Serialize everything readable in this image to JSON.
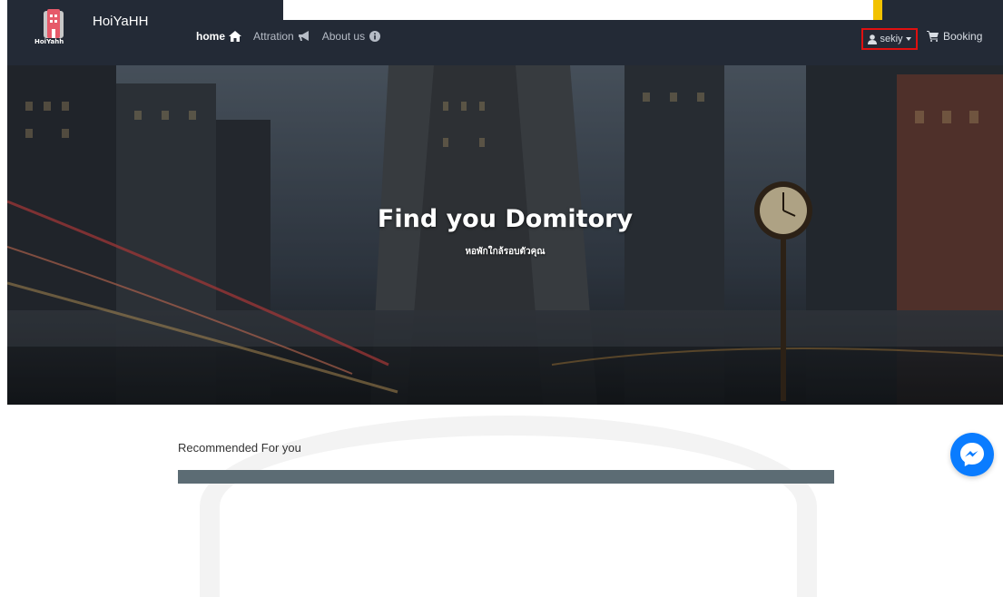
{
  "brand": {
    "name": "HoiYaHH",
    "logo_caption": "HoiYahh"
  },
  "nav": {
    "items": [
      {
        "label": "home",
        "icon": "home-icon",
        "active": true
      },
      {
        "label": "Attration",
        "icon": "bullhorn-icon",
        "active": false
      },
      {
        "label": "About us",
        "icon": "info-icon",
        "active": false
      }
    ]
  },
  "user_menu": {
    "label": "sekiy",
    "icon": "user-icon"
  },
  "booking": {
    "label": "Booking",
    "icon": "cart-icon"
  },
  "hero": {
    "title": "Find you Domitory",
    "subtitle": "หอพักใกล้รอบตัวคุณ"
  },
  "recommended": {
    "title": "Recommended For you"
  },
  "colors": {
    "navbar": "#232a36",
    "accent_red": "#e01010",
    "messenger": "#0a7cff",
    "accent_yellow": "#f2c200"
  }
}
